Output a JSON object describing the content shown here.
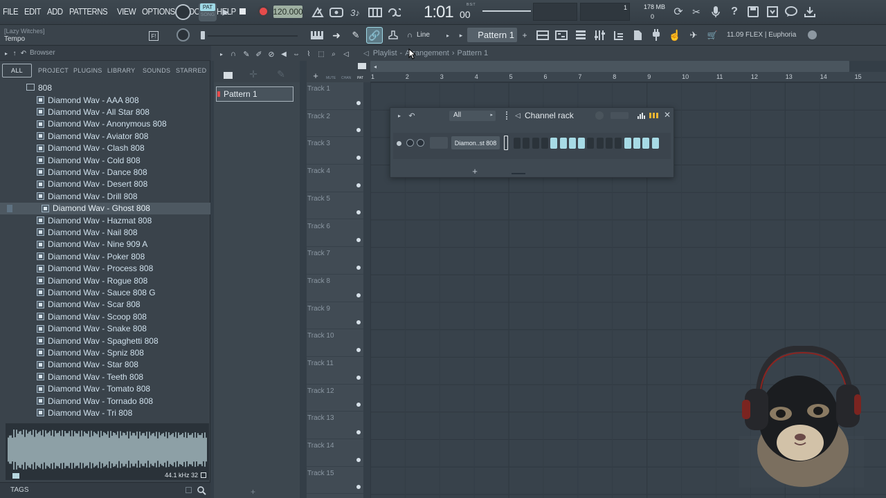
{
  "menu": [
    "FILE",
    "EDIT",
    "ADD",
    "PATTERNS",
    "VIEW",
    "OPTIONS",
    "TOOLS",
    "HELP"
  ],
  "transport": {
    "pat_label": "PAT",
    "song_label": "SONG",
    "tempo": "120.000",
    "time": "1:01",
    "time_small": "00",
    "bst": "B:S:T"
  },
  "status": {
    "cpu_value": "1",
    "memory": "178 MB",
    "polyphony": "0"
  },
  "hint": {
    "project": "[Lazy Witches]",
    "label": "Tempo"
  },
  "toolbar2": {
    "snap": "Line",
    "pattern": "Pattern 1",
    "news": "11.09  FLEX | Euphoria"
  },
  "browser": {
    "title": "Browser",
    "tabs": [
      "ALL",
      "PROJECT",
      "PLUGINS",
      "LIBRARY",
      "SOUNDS",
      "STARRED"
    ],
    "folder": "808",
    "items": [
      "Diamond Wav - AAA 808",
      "Diamond Wav - All Star 808",
      "Diamond Wav - Anonymous 808",
      "Diamond Wav - Aviator 808",
      "Diamond Wav - Clash 808",
      "Diamond Wav - Cold 808",
      "Diamond Wav - Dance 808",
      "Diamond Wav - Desert 808",
      "Diamond Wav - Drill 808",
      "Diamond Wav - Ghost 808",
      "Diamond Wav - Hazmat 808",
      "Diamond Wav - Nail 808",
      "Diamond Wav - Nine 909 A",
      "Diamond Wav - Poker 808",
      "Diamond Wav - Process 808",
      "Diamond Wav - Rogue 808",
      "Diamond Wav - Sauce 808 G",
      "Diamond Wav - Scar 808",
      "Diamond Wav - Scoop 808",
      "Diamond Wav - Snake 808",
      "Diamond Wav - Spaghetti 808",
      "Diamond Wav - Spniz 808",
      "Diamond Wav - Star 808",
      "Diamond Wav - Teeth 808",
      "Diamond Wav - Tomato 808",
      "Diamond Wav - Tornado 808",
      "Diamond Wav - Tri 808"
    ],
    "selected_index": 9,
    "sample_info": "44.1 kHz 32",
    "tags": "TAGS"
  },
  "playlist": {
    "crumb_1": "Playlist",
    "crumb_sep": "-",
    "crumb_2": "Arrangement",
    "crumb_3": "Pattern 1",
    "pattern_item": "Pattern 1",
    "bars": [
      "1",
      "2",
      "3",
      "4",
      "5",
      "6",
      "7",
      "8",
      "9",
      "10",
      "11",
      "12",
      "13",
      "14",
      "15"
    ],
    "tracks": [
      "Track 1",
      "Track 2",
      "Track 3",
      "Track 4",
      "Track 5",
      "Track 6",
      "Track 7",
      "Track 8",
      "Track 9",
      "Track 10",
      "Track 11",
      "Track 12",
      "Track 13",
      "Track 14",
      "Track 15"
    ],
    "mini_labels": [
      "MUTE",
      "CHAN",
      "PAT"
    ]
  },
  "channel_rack": {
    "title": "Channel rack",
    "filter": "All",
    "channel_name": "Diamon..st 808",
    "steps": [
      0,
      0,
      0,
      0,
      1,
      1,
      1,
      1,
      0,
      0,
      0,
      0,
      1,
      1,
      1,
      1
    ]
  },
  "colors": {
    "accent_steps": "#a7dbe6",
    "record": "#e64b4b",
    "tempo_bg": "#9fb0a2",
    "bg": "#343e47"
  }
}
